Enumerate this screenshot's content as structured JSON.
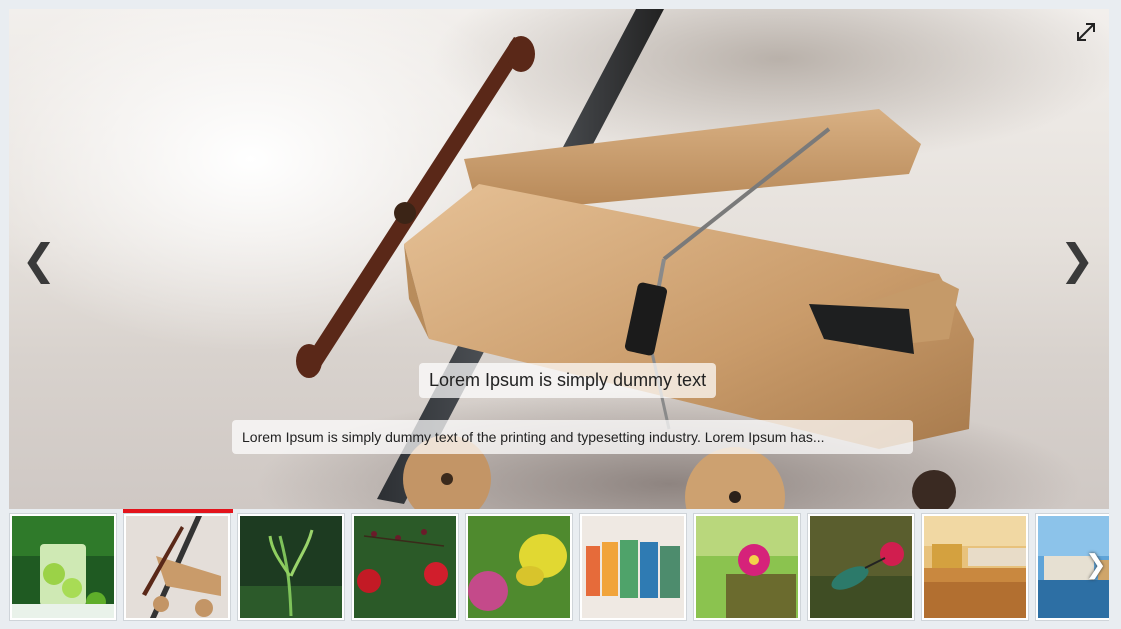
{
  "slider": {
    "caption_title": "Lorem Ipsum is simply dummy text",
    "caption_text": "Lorem Ipsum is simply dummy text of the printing and typesetting industry. Lorem Ipsum has...",
    "prev_glyph": "❮",
    "next_glyph": "❯",
    "expand_icon": "fullscreen-icon",
    "active_index": 1,
    "accent_color": "#e3131b"
  },
  "thumbnails": {
    "next_glyph": "❯",
    "items": [
      {
        "subject": "lime-drink"
      },
      {
        "subject": "wooden-toy-plane"
      },
      {
        "subject": "green-sprout"
      },
      {
        "subject": "red-flowers"
      },
      {
        "subject": "butterfly-on-clover"
      },
      {
        "subject": "colored-glasses"
      },
      {
        "subject": "pink-flower-on-stump"
      },
      {
        "subject": "hummingbird"
      },
      {
        "subject": "golden-temple"
      },
      {
        "subject": "waterfront-city"
      }
    ]
  }
}
